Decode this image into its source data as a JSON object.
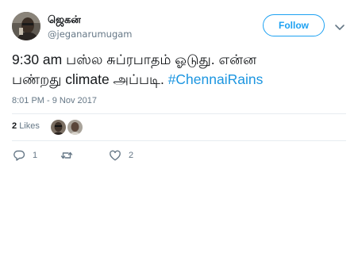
{
  "user": {
    "display_name": "ஜெகன்",
    "handle": "@jeganarumugam"
  },
  "header": {
    "follow_label": "Follow"
  },
  "tweet": {
    "text_line1": "9:30 am பஸ்ல சுப்ரபாதம் ஓடுது. என்ன",
    "text_line2_prefix": "பண்றது climate அப்படி. ",
    "hashtag": "#ChennaiRains",
    "timestamp": "8:01 PM - 9 Nov 2017"
  },
  "stats": {
    "like_count": "2",
    "likes_label": "Likes"
  },
  "actions": {
    "reply_count": "1",
    "retweet_count": "",
    "like_count": "2"
  },
  "colors": {
    "accent": "#1da1f2",
    "hashtag": "#1b95e0",
    "muted": "#657786",
    "divider": "#e6ecf0"
  },
  "icons": {
    "more": "chevron-down-icon",
    "reply": "reply-icon",
    "retweet": "retweet-icon",
    "like": "heart-icon"
  }
}
